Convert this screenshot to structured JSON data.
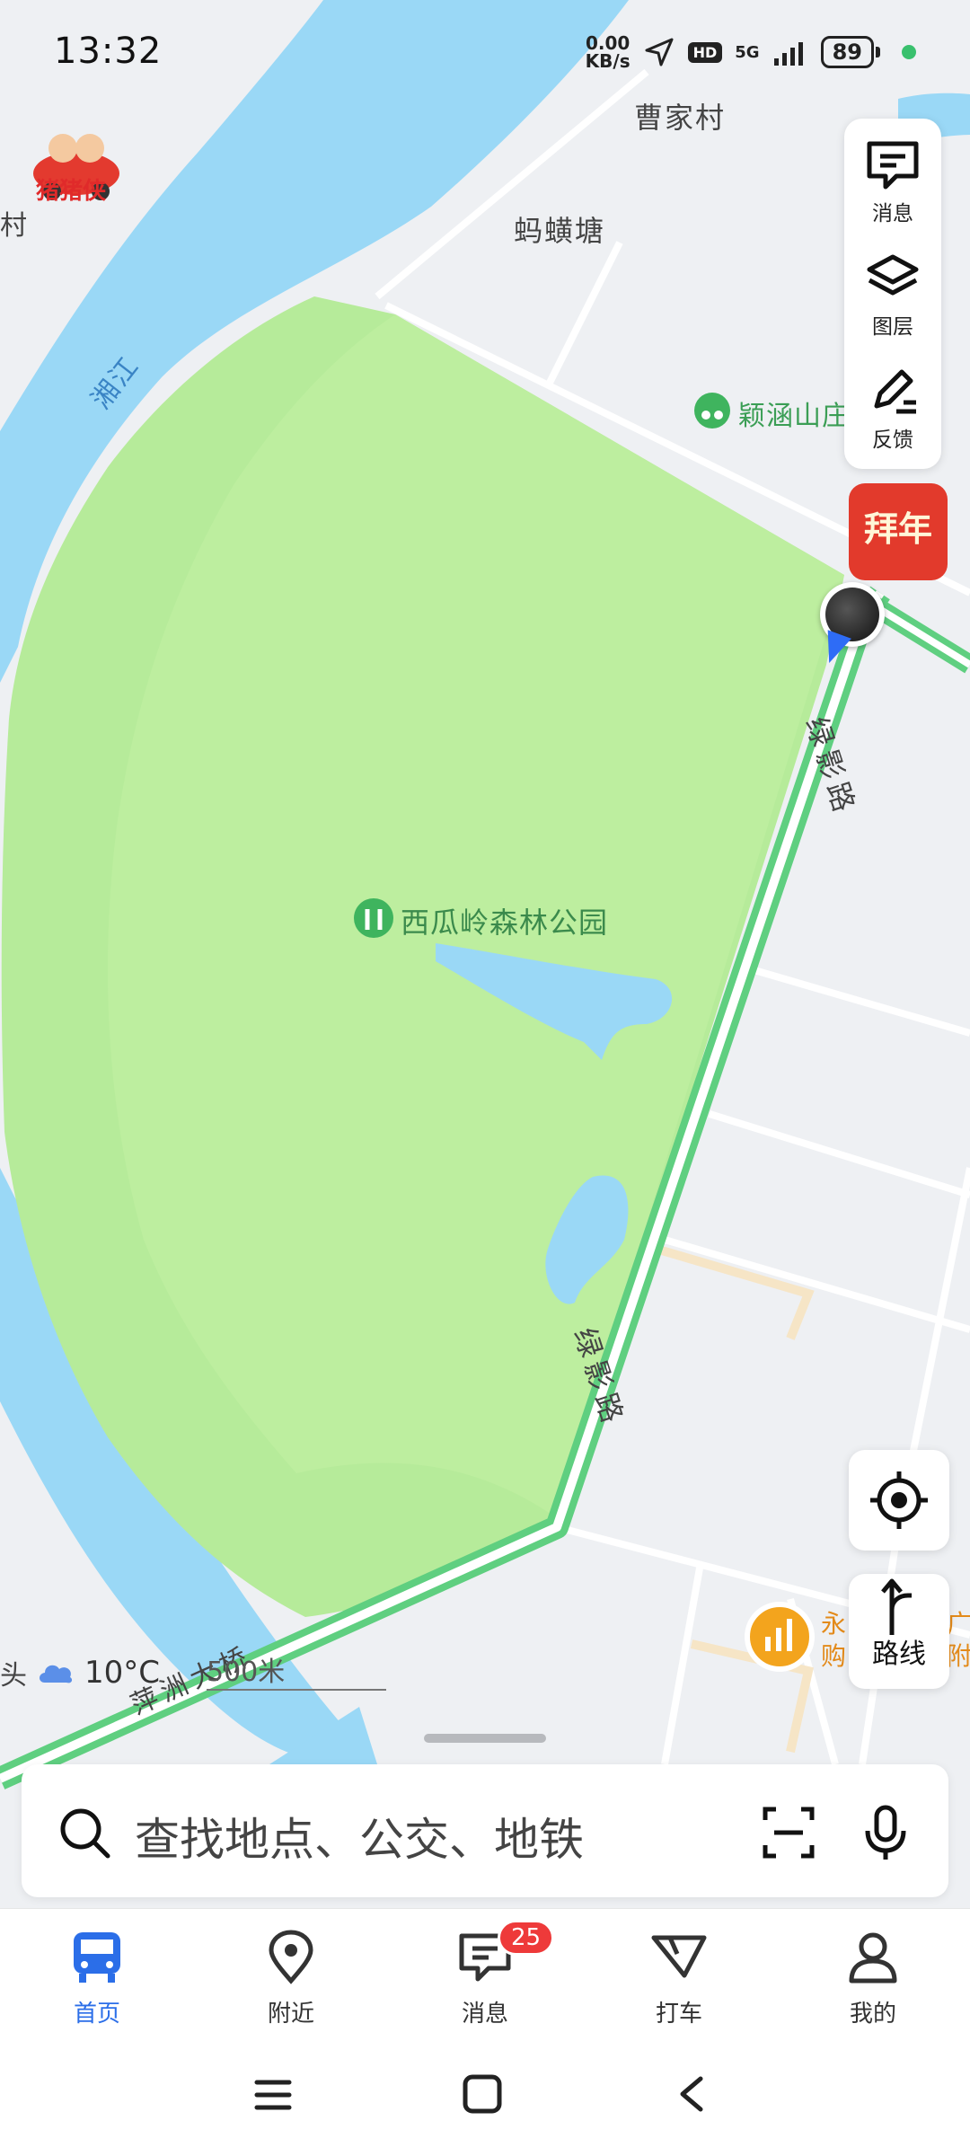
{
  "status_bar": {
    "time": "13:32",
    "net_speed_top": "0.00",
    "net_speed_unit": "KB/s",
    "hd": "HD",
    "network": "5G",
    "battery": "89"
  },
  "logo_text": "猪猪侠",
  "map_labels": {
    "village_left": "村",
    "cao_jia_cun": "曹家村",
    "ma_huang_tang": "蚂蟥塘",
    "xiang_jiang": "湘江",
    "ying_han_shan": "颖涵山庄",
    "park": "西瓜岭森林公园",
    "road_top": "绿影路",
    "road_bottom": "绿影路",
    "bridge": "萍洲大桥",
    "poi_right_1": "永",
    "poi_right_2": "购",
    "poi_right_3": "广",
    "poi_right_4": "附"
  },
  "toolbar": {
    "messages": "消息",
    "layers": "图层",
    "feedback": "反馈"
  },
  "new_year": "拜年",
  "route_button": "路线",
  "weather": {
    "temp": "10°C",
    "edge_char": "头"
  },
  "scale": "500米",
  "search": {
    "placeholder": "查找地点、公交、地铁"
  },
  "tabs": {
    "home": "首页",
    "nearby": "附近",
    "messages": "消息",
    "taxi": "打车",
    "mine": "我的",
    "messages_badge": "25"
  },
  "colors": {
    "river": "#9ad8f6",
    "park": "#b6eb9a",
    "road": "#5fcf80",
    "accent": "#2b6ee8",
    "badge": "#ee3a3a"
  }
}
